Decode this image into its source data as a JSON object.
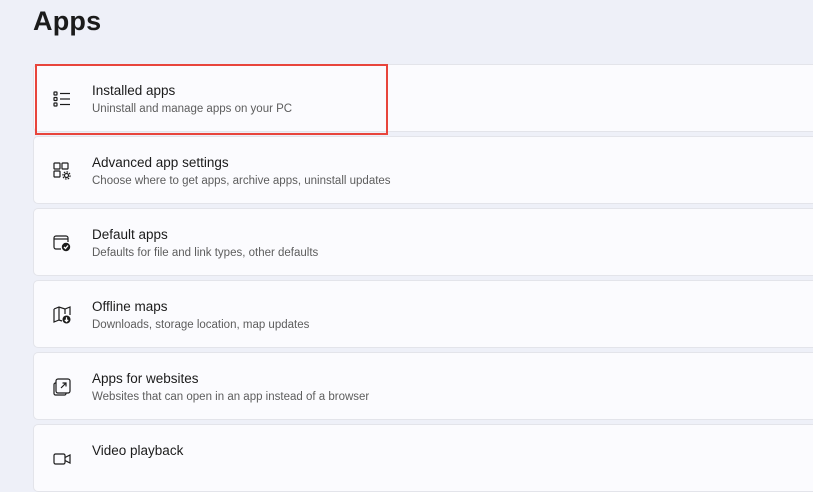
{
  "page": {
    "title": "Apps"
  },
  "items": [
    {
      "title": "Installed apps",
      "subtitle": "Uninstall and manage apps on your PC",
      "icon": "installed-apps-list-icon"
    },
    {
      "title": "Advanced app settings",
      "subtitle": "Choose where to get apps, archive apps, uninstall updates",
      "icon": "advanced-app-settings-icon"
    },
    {
      "title": "Default apps",
      "subtitle": "Defaults for file and link types, other defaults",
      "icon": "default-apps-icon"
    },
    {
      "title": "Offline maps",
      "subtitle": "Downloads, storage location, map updates",
      "icon": "offline-maps-icon"
    },
    {
      "title": "Apps for websites",
      "subtitle": "Websites that can open in an app instead of a browser",
      "icon": "apps-for-websites-icon"
    },
    {
      "title": "Video playback",
      "subtitle": "",
      "icon": "video-playback-icon"
    }
  ],
  "highlight": {
    "color": "#e8453c",
    "target": "Installed apps"
  }
}
